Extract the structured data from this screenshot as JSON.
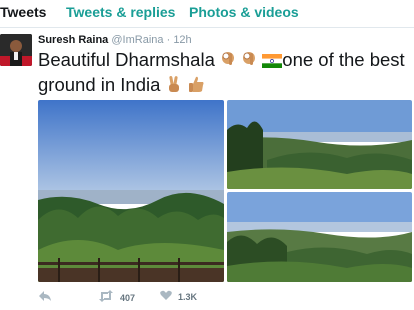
{
  "tabs": [
    {
      "label": "Tweets"
    },
    {
      "label": "Tweets & replies"
    },
    {
      "label": "Photos & videos"
    }
  ],
  "tweet": {
    "author_name": "Suresh Raina",
    "author_handle": "@ImRaina",
    "time": "12h",
    "text_part1": "Beautiful Dharmshala",
    "text_part2": "one of the best ground in India",
    "emojis": [
      "ok-hand",
      "ok-hand",
      "india-flag",
      "victory-hand",
      "thumbs-up"
    ],
    "retweets": "407",
    "likes": "1.3K"
  },
  "colors": {
    "accent": "#1a9e96",
    "muted": "#8899a6",
    "text": "#14171a"
  },
  "icons": [
    "reply-icon",
    "retweet-icon",
    "like-icon"
  ]
}
